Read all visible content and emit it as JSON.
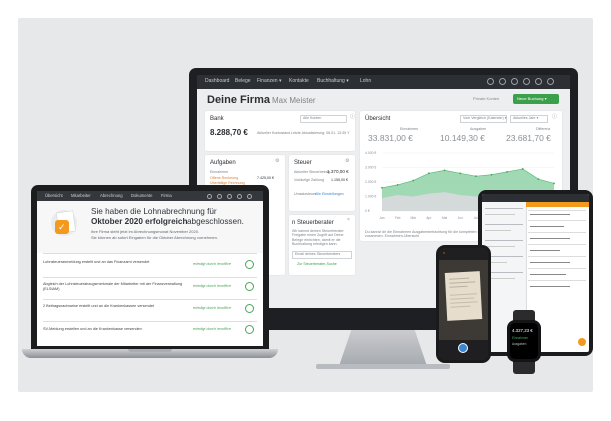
{
  "monitor": {
    "nav": [
      "Dashboard",
      "Belege",
      "Finanzen ▾",
      "Kontakte",
      "Buchhaltung ▾",
      "Lohn"
    ],
    "title": "Deine Firma",
    "subtitle": "Max Meister",
    "private_label": "Private Konten",
    "new_button": "Neue Buchung ▾",
    "bank": {
      "title": "Bank",
      "select": "Alle Konten",
      "amount": "8.288,70 €",
      "amount_note": "Aktueller Kontostand",
      "update_note": "Letzte Aktualisierung: 06.01. 13:35 Y"
    },
    "overview": {
      "title": "Übersicht",
      "filter": "Vom Vergleich (Kalender) ▾",
      "filter2": "Aktuelles Jahr ▾",
      "labels": [
        "Einnahmen",
        "Ausgaben",
        "Differenz"
      ],
      "values": [
        "33.831,00 €",
        "10.149,30 €",
        "23.681,70 €"
      ],
      "legend": [
        "Einnahmen",
        "Ausgaben"
      ],
      "y_ticks": [
        "4.000 €",
        "3.000 €",
        "2.000 €",
        "1.000 €",
        "0 €"
      ],
      "x_ticks": [
        "Jan",
        "Feb",
        "Mär",
        "Apr",
        "Mai",
        "Jun",
        "Jul",
        "Aug",
        "Sep",
        "Okt",
        "Nov",
        "Dez"
      ],
      "footnote": "Du kannst dir die Einnahmen Ausgabenbetrachtung für die kompletten Daten lassen der Einnahmen und Ausgaben zusammen. Einnahmen-Übersicht",
      "footnote_link": "Einnahmen-Übersicht"
    },
    "tasks": {
      "title": "Aufgaben",
      "section": "Einnahmen",
      "items": [
        {
          "label": "Offene Rechnung",
          "value": "7.425,00 €"
        },
        {
          "label": "Überfällige Rechnung",
          "value": ""
        }
      ]
    },
    "tax": {
      "title": "Steuer",
      "rows": [
        {
          "label": "Aktueller Steuerbetrag",
          "value": "1.370,00 €"
        },
        {
          "label": "Vorläufige Zahlung",
          "value": "1.155,00 €"
        }
      ],
      "note": "Umsatzsteuer",
      "link": "Alle Einstellungen"
    },
    "advisor": {
      "title": "n Steuerberater",
      "text": "Wir kannst deinen Steuerberater Freigabe einen Zugriff auf Deine Belege einrichten, damit er die Buchhaltung erledigen kann.",
      "input": "Email deines Steuerberaters",
      "link": "Zur Steuerberater-Suche"
    }
  },
  "chart_data": {
    "type": "area",
    "categories": [
      "Jan",
      "Feb",
      "Mär",
      "Apr",
      "Mai",
      "Jun",
      "Jul",
      "Aug",
      "Sep",
      "Okt",
      "Nov",
      "Dez"
    ],
    "series": [
      {
        "name": "Einnahmen",
        "values": [
          1600,
          1800,
          2100,
          2600,
          2800,
          2600,
          2400,
          2500,
          2700,
          2900,
          2200,
          1900
        ]
      },
      {
        "name": "Ausgaben",
        "values": [
          900,
          1100,
          1000,
          1200,
          1300,
          1100,
          1000,
          1200,
          1100,
          1300,
          1000,
          900
        ]
      }
    ],
    "ylim": [
      0,
      4000
    ],
    "colors": {
      "income": "#8fd2a7",
      "expense": "#d7d9dc"
    }
  },
  "laptop": {
    "nav": [
      "Übersicht",
      "Mitarbeiter",
      "Abrechnung",
      "Dokumente",
      "Firma"
    ],
    "headline_1": "Sie haben die Lohnabrechnung für",
    "headline_2": "Oktober 2020 erfolgreich",
    "headline_3": "abgeschlossen.",
    "line_1": "Ihre Firma steht jetzt im Abrechnungsmonat November 2020.",
    "line_2": "Sie können ab sofort Eingaben für die Oktober Abrechnung vornehmen.",
    "rows": [
      {
        "text": "Lohnsteueranmeldung erstellt und an das Finanzamt versendet",
        "status": "erledigt durch lexoffice"
      },
      {
        "text": "Abgleich der Lohnsteuerabzugsmerkmale der Mitarbeiter mit der Finanzverwaltung (ELStAM)",
        "status": "erledigt durch lexoffice"
      },
      {
        "text": "2 Beitragsnachweise erstellt und an die Krankenkassen versendet",
        "status": "erledigt durch lexoffice"
      },
      {
        "text": "SV-Meldung erstellen und an die Krankenkasse versenden",
        "status": "erledigt durch lexoffice"
      }
    ]
  },
  "watch": {
    "amount": "4.327,23 €",
    "labels": [
      "Einnahmen",
      "Ausgaben"
    ]
  },
  "colors": {
    "accent": "#f39a1e",
    "success": "#4aa35a",
    "nav": "#2c2f33"
  }
}
